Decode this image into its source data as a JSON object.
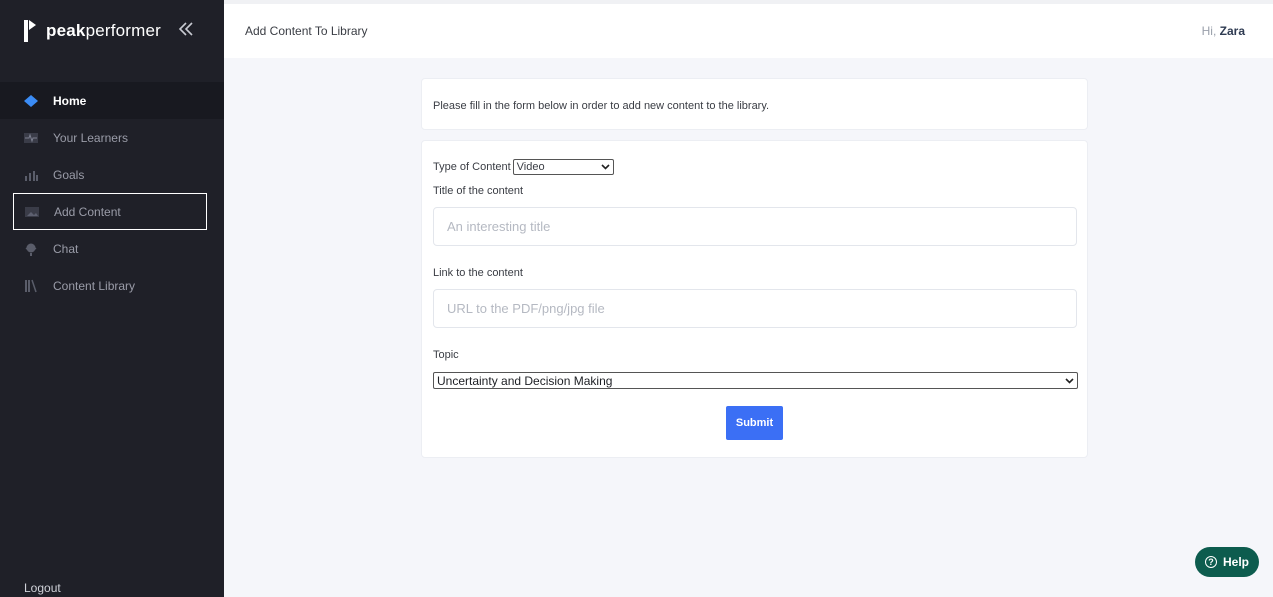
{
  "brand": {
    "name_bold": "peak",
    "name_rest": "performer"
  },
  "sidebar": {
    "items": [
      {
        "label": "Home",
        "icon": "diamond-icon",
        "active": true
      },
      {
        "label": "Your Learners",
        "icon": "pulse-icon"
      },
      {
        "label": "Goals",
        "icon": "bar-chart-icon"
      },
      {
        "label": "Add Content",
        "icon": "image-icon",
        "focused": true
      },
      {
        "label": "Chat",
        "icon": "chat-icon"
      },
      {
        "label": "Content Library",
        "icon": "library-icon"
      }
    ],
    "logout_label": "Logout"
  },
  "header": {
    "title": "Add Content To Library",
    "greeting_prefix": "Hi,",
    "user_name": "Zara"
  },
  "form": {
    "intro": "Please fill in the form below in order to add new content to the library.",
    "type_label": "Type of Content",
    "type_value": "Video",
    "title_label": "Title of the content",
    "title_placeholder": "An interesting title",
    "link_label": "Link to the content",
    "link_placeholder": "URL to the PDF/png/jpg file",
    "topic_label": "Topic",
    "topic_value": "Uncertainty and Decision Making",
    "submit_label": "Submit"
  },
  "help": {
    "label": "Help"
  },
  "colors": {
    "accent": "#3b6ff5",
    "sidebar": "#1f2028",
    "help": "#0d5c4e"
  }
}
